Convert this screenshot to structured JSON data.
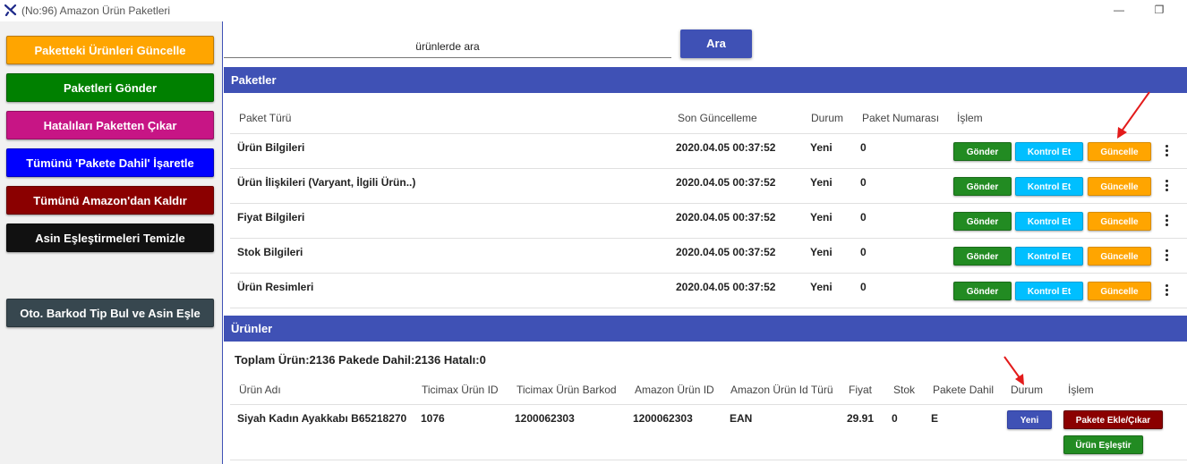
{
  "window": {
    "title": "(No:96) Amazon Ürün Paketleri",
    "minimize": "—",
    "restore": "❐"
  },
  "sidebar": {
    "buttons": [
      {
        "label": "Paketteki Ürünleri Güncelle",
        "color": "#ffa500",
        "text": "#ffffff"
      },
      {
        "label": "Paketleri Gönder",
        "color": "#008000",
        "text": "#ffffff"
      },
      {
        "label": "Hatalıları Paketten Çıkar",
        "color": "#c71585",
        "text": "#ffffff"
      },
      {
        "label": "Tümünü 'Pakete Dahil' İşaretle",
        "color": "#0000ff",
        "text": "#ffffff"
      },
      {
        "label": "Tümünü Amazon'dan Kaldır",
        "color": "#8b0000",
        "text": "#ffffff"
      },
      {
        "label": "Asin Eşleştirmeleri Temizle",
        "color": "#111111",
        "text": "#ffffff"
      },
      {
        "label": "Oto. Barkod Tip Bul ve Asin Eşle",
        "color": "#37474f",
        "text": "#ffffff"
      }
    ]
  },
  "search": {
    "placeholder": "ürünlerde ara",
    "button_label": "Ara"
  },
  "paketler": {
    "title": "Paketler",
    "columns": [
      "Paket Türü",
      "Son Güncelleme",
      "Durum",
      "Paket Numarası",
      "İşlem"
    ],
    "rows": [
      {
        "type": "Ürün Bilgileri",
        "updated": "2020.04.05 00:37:52",
        "status": "Yeni",
        "number": "0"
      },
      {
        "type": "Ürün İlişkileri (Varyant, İlgili Ürün..)",
        "updated": "2020.04.05 00:37:52",
        "status": "Yeni",
        "number": "0"
      },
      {
        "type": "Fiyat Bilgileri",
        "updated": "2020.04.05 00:37:52",
        "status": "Yeni",
        "number": "0"
      },
      {
        "type": "Stok Bilgileri",
        "updated": "2020.04.05 00:37:52",
        "status": "Yeni",
        "number": "0"
      },
      {
        "type": "Ürün Resimleri",
        "updated": "2020.04.05 00:37:52",
        "status": "Yeni",
        "number": "0"
      }
    ],
    "actions": {
      "send": "Gönder",
      "check": "Kontrol Et",
      "update": "Güncelle"
    }
  },
  "urunler": {
    "title": "Ürünler",
    "summary": "Toplam Ürün:2136 Pakede Dahil:2136 Hatalı:0",
    "columns": [
      "Ürün Adı",
      "Ticimax Ürün ID",
      "Ticimax Ürün Barkod",
      "Amazon Ürün ID",
      "Amazon Ürün Id Türü",
      "Fiyat",
      "Stok",
      "Pakete Dahil",
      "Durum",
      "İşlem"
    ],
    "rows": [
      {
        "name": "Siyah Kadın Ayakkabı B65218270",
        "ticimax_id": "1076",
        "barcode": "1200062303",
        "amazon_id": "1200062303",
        "id_type": "EAN",
        "price": "29.91",
        "stock": "0",
        "included": "E",
        "status": "Yeni",
        "action1": "Pakete Ekle/Çıkar",
        "action2": "Ürün Eşleştir"
      }
    ]
  },
  "colors": {
    "accent": "#3f51b5",
    "annotation_arrow": "#e31b1b"
  }
}
